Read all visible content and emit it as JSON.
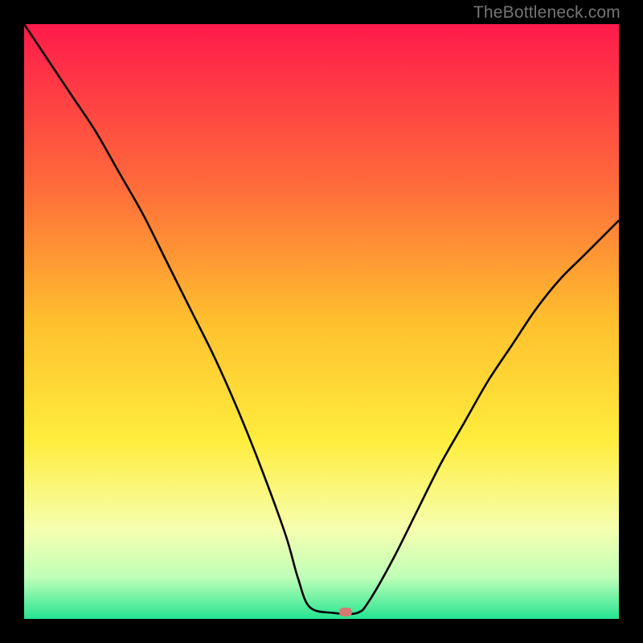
{
  "watermark": "TheBottleneck.com",
  "chart_data": {
    "type": "line",
    "title": "",
    "xlabel": "",
    "ylabel": "",
    "xlim": [
      0,
      100
    ],
    "ylim": [
      0,
      100
    ],
    "grid": false,
    "legend": false,
    "background_gradient": {
      "stops": [
        {
          "offset": 0.0,
          "color": "#ff1a4b"
        },
        {
          "offset": 0.28,
          "color": "#ff6e3a"
        },
        {
          "offset": 0.5,
          "color": "#ffc02e"
        },
        {
          "offset": 0.7,
          "color": "#ffed3d"
        },
        {
          "offset": 0.85,
          "color": "#f6ffb0"
        },
        {
          "offset": 0.93,
          "color": "#c0ffb8"
        },
        {
          "offset": 1.0,
          "color": "#25e591"
        }
      ]
    },
    "series": [
      {
        "name": "bottleneck-curve",
        "color": "#000000",
        "x": [
          0,
          4,
          8,
          12,
          16,
          20,
          24,
          28,
          32,
          36,
          40,
          44,
          46,
          48,
          52,
          56,
          58,
          62,
          66,
          70,
          74,
          78,
          82,
          86,
          90,
          94,
          98,
          100
        ],
        "y": [
          100,
          94,
          88,
          82,
          75,
          68,
          60,
          52,
          44,
          35,
          25,
          14,
          7,
          2,
          1,
          1,
          3,
          10,
          18,
          26,
          33,
          40,
          46,
          52,
          57,
          61,
          65,
          67
        ]
      }
    ],
    "marker": {
      "name": "optimal-point",
      "x": 54,
      "y": 1.2,
      "color": "#d47a72"
    }
  }
}
